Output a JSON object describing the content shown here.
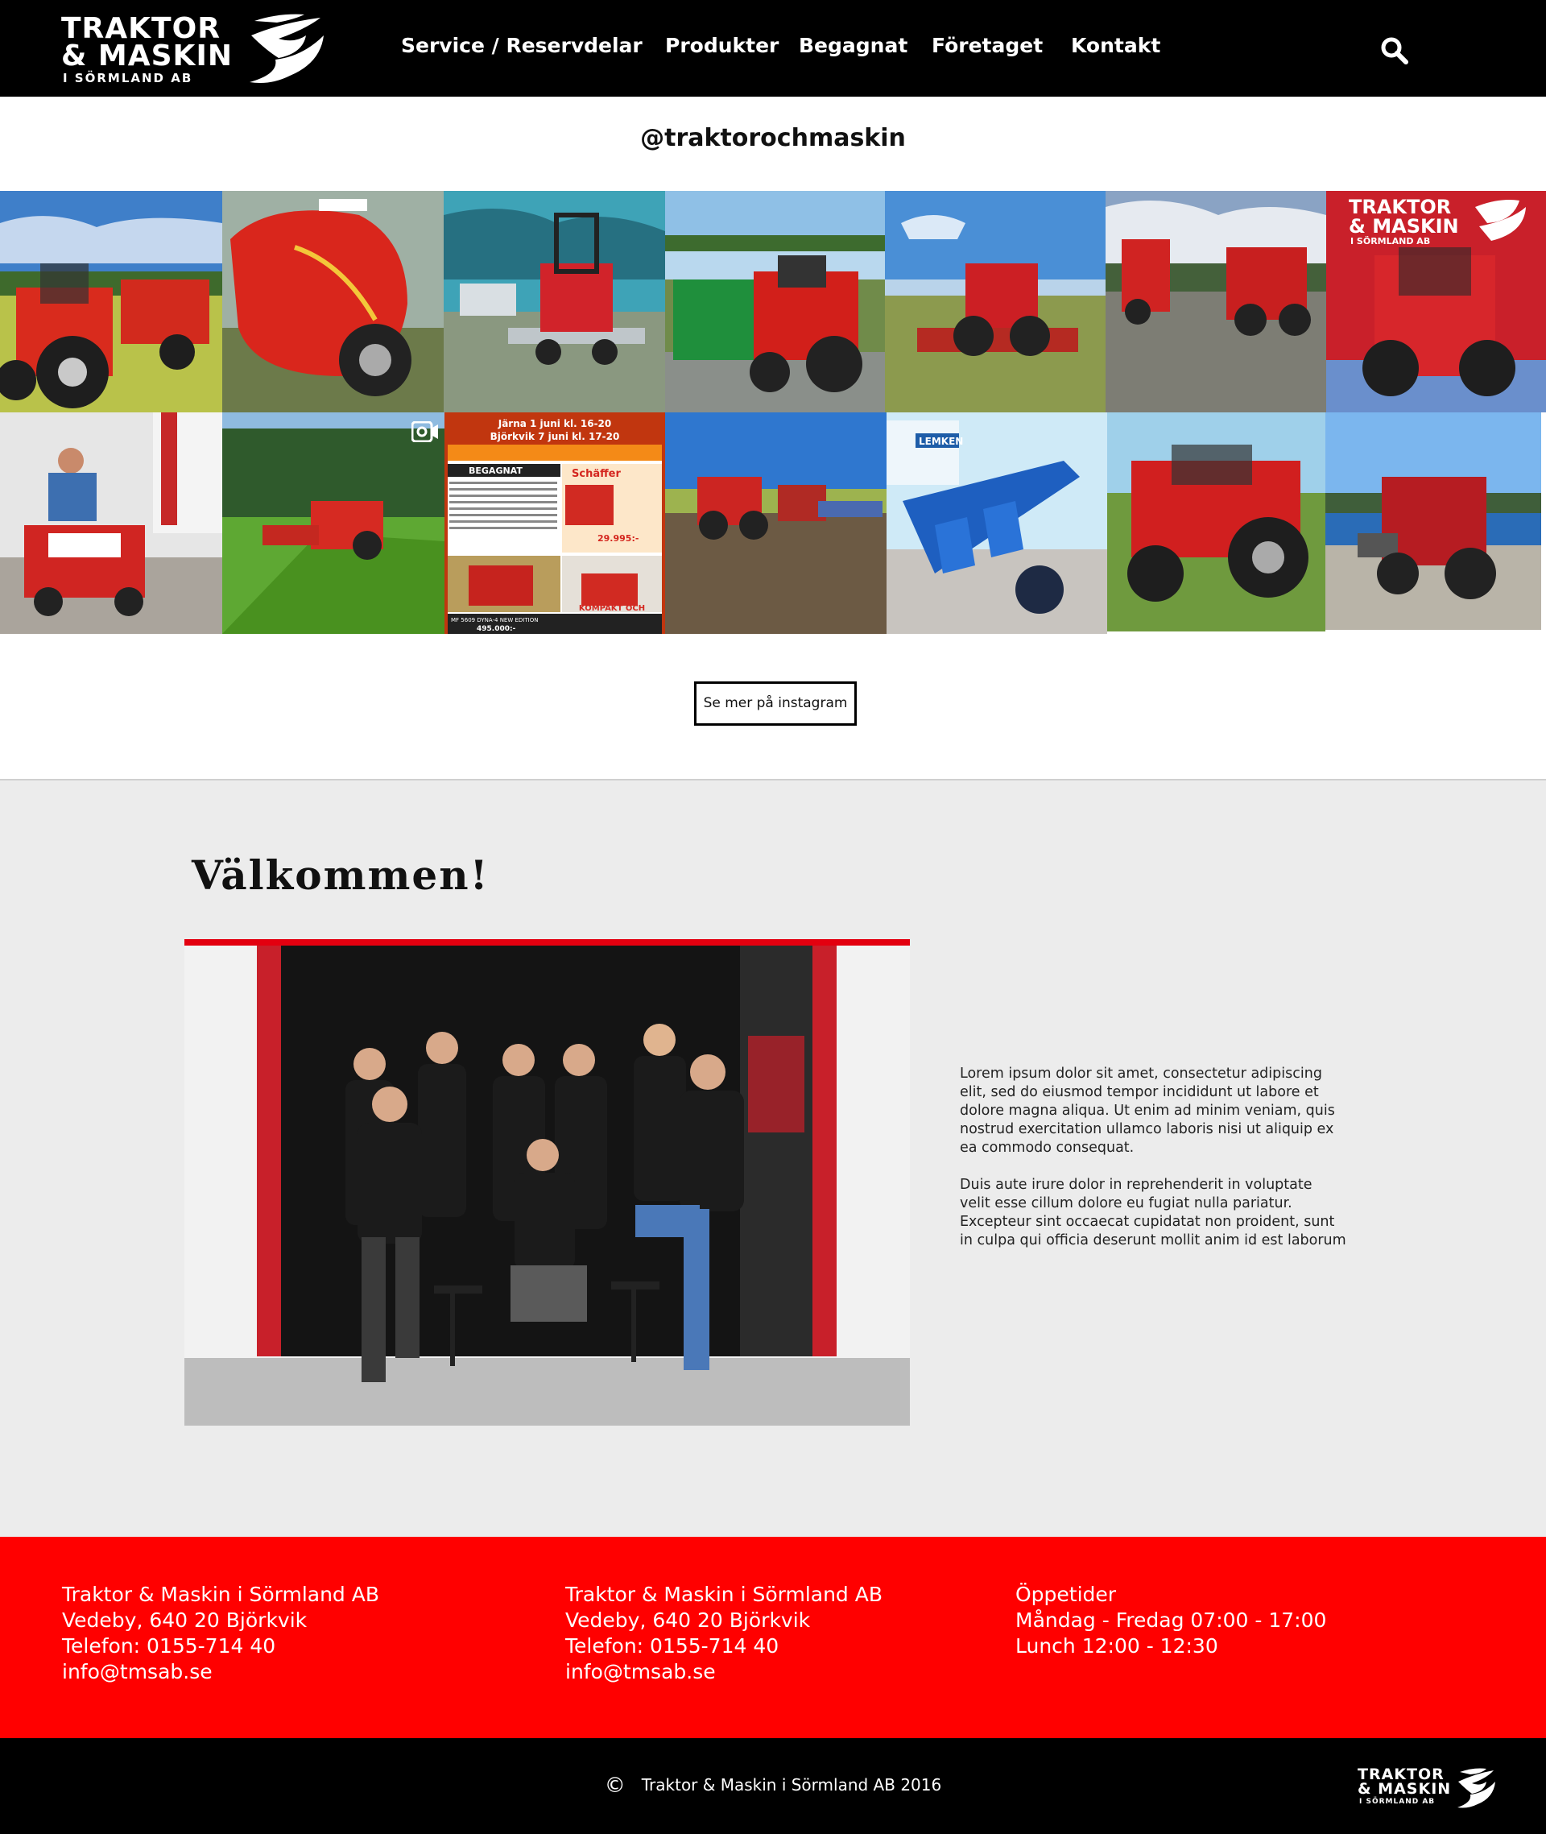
{
  "header": {
    "logo": {
      "line1": "TRAKTOR",
      "line2": "& MASKIN",
      "line3": "I SÖRMLAND AB"
    },
    "nav": [
      {
        "label": "Service / Reservdelar"
      },
      {
        "label": "Produkter"
      },
      {
        "label": "Begagnat"
      },
      {
        "label": "Företaget"
      },
      {
        "label": "Kontakt"
      }
    ],
    "search_icon": "search-icon"
  },
  "instagram": {
    "handle": "@traktorochmaskin",
    "tiles": [
      {
        "subject": "tractor-with-baler"
      },
      {
        "subject": "red-round-baler"
      },
      {
        "subject": "loader-on-trailer"
      },
      {
        "subject": "tractor-with-baler-lake"
      },
      {
        "subject": "tractor-with-mower"
      },
      {
        "subject": "compact-loaders"
      },
      {
        "subject": "tractor-at-red-building-with-logo",
        "sign_line1": "TRAKTOR",
        "sign_line2": "& MASKIN",
        "sign_line3": "I SÖRMLAND AB"
      },
      {
        "subject": "man-on-ride-on-mower"
      },
      {
        "subject": "tractor-mowing-grass",
        "has_video_icon": true
      },
      {
        "subject": "event-flyer",
        "flyer_line1": "Järna 1 juni kl. 16-20",
        "flyer_line2": "Björkvik 7 juni kl. 17-20",
        "flyer_label1": "BEGAGNAT",
        "flyer_label2": "Schäffer",
        "flyer_label3": "29.995:-",
        "flyer_label4": "KOMPAKT OCH",
        "flyer_label5": "MF 5609 DYNA-4 NEW EDITION",
        "flyer_label6": "495.000:-"
      },
      {
        "subject": "two-tractors-field"
      },
      {
        "subject": "blue-lemken-plough",
        "brand_label": "LEMKEN"
      },
      {
        "subject": "red-tractor-closeup"
      },
      {
        "subject": "tractor-with-loader-lake"
      }
    ],
    "more_button": "Se mer på instagram"
  },
  "welcome": {
    "title": "Välkommen!",
    "photo_subject": "staff-team-photo",
    "paragraphs": [
      "Lorem ipsum dolor sit amet, consectetur adipiscing elit, sed do eiusmod tempor incididunt ut labore et dolore magna aliqua. Ut enim ad minim veniam, quis nostrud exercitation ullamco laboris nisi ut aliquip ex ea commodo consequat.",
      "Duis aute irure dolor in reprehenderit in voluptate velit esse cillum dolore eu fugiat nulla pariatur. Excepteur sint occaecat cupidatat non proident, sunt in culpa qui officia deserunt mollit anim id est laborum"
    ]
  },
  "footer": {
    "columns": [
      {
        "lines": [
          "Traktor & Maskin i Sörmland AB",
          "Vedeby, 640 20 Björkvik",
          "Telefon: 0155-714 40",
          "info@tmsab.se"
        ]
      },
      {
        "lines": [
          "Traktor & Maskin i Sörmland AB",
          "Vedeby, 640 20 Björkvik",
          "Telefon: 0155-714 40",
          "info@tmsab.se"
        ]
      },
      {
        "lines": [
          "Öppetider",
          "Måndag - Fredag 07:00 - 17:00",
          "Lunch 12:00 - 12:30"
        ]
      }
    ],
    "copyright_symbol": "©",
    "copyright": "Traktor & Maskin i Sörmland AB 2016",
    "logo": {
      "line1": "TRAKTOR",
      "line2": "& MASKIN",
      "line3": "I SÖRMLAND AB"
    }
  },
  "colors": {
    "brand_red": "#ff0000",
    "header_bg": "#000000",
    "welcome_bg": "#ececec"
  }
}
